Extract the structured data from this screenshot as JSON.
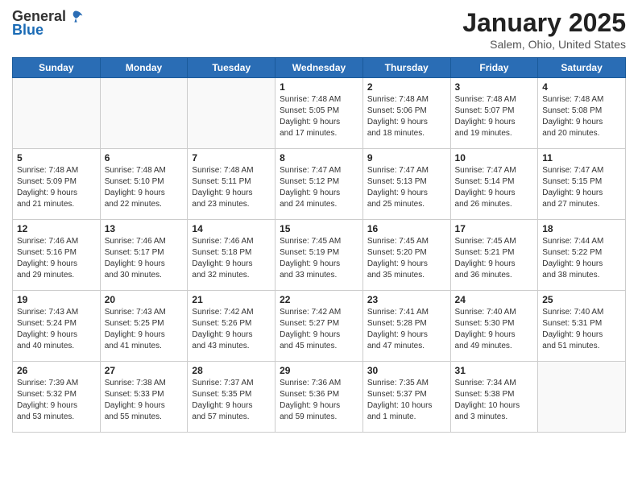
{
  "header": {
    "logo_general": "General",
    "logo_blue": "Blue",
    "title": "January 2025",
    "subtitle": "Salem, Ohio, United States"
  },
  "days_of_week": [
    "Sunday",
    "Monday",
    "Tuesday",
    "Wednesday",
    "Thursday",
    "Friday",
    "Saturday"
  ],
  "weeks": [
    [
      {
        "day": "",
        "info": ""
      },
      {
        "day": "",
        "info": ""
      },
      {
        "day": "",
        "info": ""
      },
      {
        "day": "1",
        "info": "Sunrise: 7:48 AM\nSunset: 5:05 PM\nDaylight: 9 hours\nand 17 minutes."
      },
      {
        "day": "2",
        "info": "Sunrise: 7:48 AM\nSunset: 5:06 PM\nDaylight: 9 hours\nand 18 minutes."
      },
      {
        "day": "3",
        "info": "Sunrise: 7:48 AM\nSunset: 5:07 PM\nDaylight: 9 hours\nand 19 minutes."
      },
      {
        "day": "4",
        "info": "Sunrise: 7:48 AM\nSunset: 5:08 PM\nDaylight: 9 hours\nand 20 minutes."
      }
    ],
    [
      {
        "day": "5",
        "info": "Sunrise: 7:48 AM\nSunset: 5:09 PM\nDaylight: 9 hours\nand 21 minutes."
      },
      {
        "day": "6",
        "info": "Sunrise: 7:48 AM\nSunset: 5:10 PM\nDaylight: 9 hours\nand 22 minutes."
      },
      {
        "day": "7",
        "info": "Sunrise: 7:48 AM\nSunset: 5:11 PM\nDaylight: 9 hours\nand 23 minutes."
      },
      {
        "day": "8",
        "info": "Sunrise: 7:47 AM\nSunset: 5:12 PM\nDaylight: 9 hours\nand 24 minutes."
      },
      {
        "day": "9",
        "info": "Sunrise: 7:47 AM\nSunset: 5:13 PM\nDaylight: 9 hours\nand 25 minutes."
      },
      {
        "day": "10",
        "info": "Sunrise: 7:47 AM\nSunset: 5:14 PM\nDaylight: 9 hours\nand 26 minutes."
      },
      {
        "day": "11",
        "info": "Sunrise: 7:47 AM\nSunset: 5:15 PM\nDaylight: 9 hours\nand 27 minutes."
      }
    ],
    [
      {
        "day": "12",
        "info": "Sunrise: 7:46 AM\nSunset: 5:16 PM\nDaylight: 9 hours\nand 29 minutes."
      },
      {
        "day": "13",
        "info": "Sunrise: 7:46 AM\nSunset: 5:17 PM\nDaylight: 9 hours\nand 30 minutes."
      },
      {
        "day": "14",
        "info": "Sunrise: 7:46 AM\nSunset: 5:18 PM\nDaylight: 9 hours\nand 32 minutes."
      },
      {
        "day": "15",
        "info": "Sunrise: 7:45 AM\nSunset: 5:19 PM\nDaylight: 9 hours\nand 33 minutes."
      },
      {
        "day": "16",
        "info": "Sunrise: 7:45 AM\nSunset: 5:20 PM\nDaylight: 9 hours\nand 35 minutes."
      },
      {
        "day": "17",
        "info": "Sunrise: 7:45 AM\nSunset: 5:21 PM\nDaylight: 9 hours\nand 36 minutes."
      },
      {
        "day": "18",
        "info": "Sunrise: 7:44 AM\nSunset: 5:22 PM\nDaylight: 9 hours\nand 38 minutes."
      }
    ],
    [
      {
        "day": "19",
        "info": "Sunrise: 7:43 AM\nSunset: 5:24 PM\nDaylight: 9 hours\nand 40 minutes."
      },
      {
        "day": "20",
        "info": "Sunrise: 7:43 AM\nSunset: 5:25 PM\nDaylight: 9 hours\nand 41 minutes."
      },
      {
        "day": "21",
        "info": "Sunrise: 7:42 AM\nSunset: 5:26 PM\nDaylight: 9 hours\nand 43 minutes."
      },
      {
        "day": "22",
        "info": "Sunrise: 7:42 AM\nSunset: 5:27 PM\nDaylight: 9 hours\nand 45 minutes."
      },
      {
        "day": "23",
        "info": "Sunrise: 7:41 AM\nSunset: 5:28 PM\nDaylight: 9 hours\nand 47 minutes."
      },
      {
        "day": "24",
        "info": "Sunrise: 7:40 AM\nSunset: 5:30 PM\nDaylight: 9 hours\nand 49 minutes."
      },
      {
        "day": "25",
        "info": "Sunrise: 7:40 AM\nSunset: 5:31 PM\nDaylight: 9 hours\nand 51 minutes."
      }
    ],
    [
      {
        "day": "26",
        "info": "Sunrise: 7:39 AM\nSunset: 5:32 PM\nDaylight: 9 hours\nand 53 minutes."
      },
      {
        "day": "27",
        "info": "Sunrise: 7:38 AM\nSunset: 5:33 PM\nDaylight: 9 hours\nand 55 minutes."
      },
      {
        "day": "28",
        "info": "Sunrise: 7:37 AM\nSunset: 5:35 PM\nDaylight: 9 hours\nand 57 minutes."
      },
      {
        "day": "29",
        "info": "Sunrise: 7:36 AM\nSunset: 5:36 PM\nDaylight: 9 hours\nand 59 minutes."
      },
      {
        "day": "30",
        "info": "Sunrise: 7:35 AM\nSunset: 5:37 PM\nDaylight: 10 hours\nand 1 minute."
      },
      {
        "day": "31",
        "info": "Sunrise: 7:34 AM\nSunset: 5:38 PM\nDaylight: 10 hours\nand 3 minutes."
      },
      {
        "day": "",
        "info": ""
      }
    ]
  ]
}
